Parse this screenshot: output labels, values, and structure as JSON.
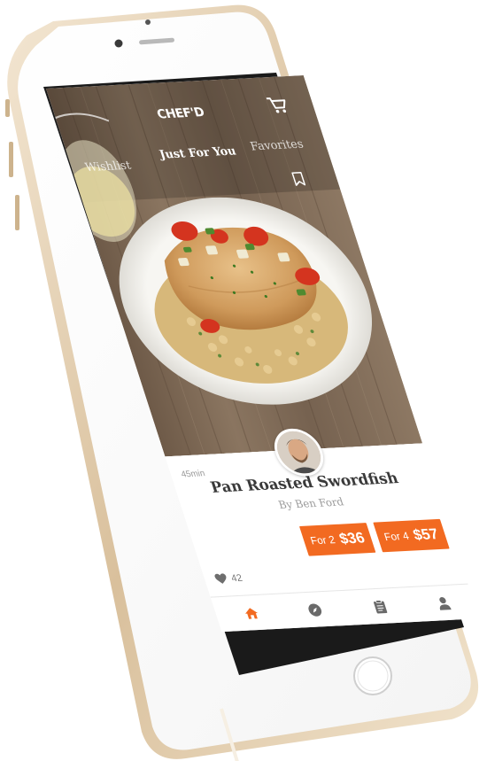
{
  "header": {
    "logo_text": "CHEF'D"
  },
  "tabs": [
    {
      "label": "Wishlist",
      "active": false
    },
    {
      "label": "Just For You",
      "active": true
    },
    {
      "label": "Favorites",
      "active": false
    }
  ],
  "recipe": {
    "duration": "45min",
    "title": "Pan Roasted Swordfish",
    "byline": "By Ben Ford",
    "likes": "42"
  },
  "pricing": [
    {
      "size_label": "For 2",
      "price": "$36"
    },
    {
      "size_label": "For 4",
      "price": "$57"
    }
  ],
  "bottom_nav": [
    {
      "icon": "home-icon",
      "active": true
    },
    {
      "icon": "compass-icon",
      "active": false
    },
    {
      "icon": "clipboard-icon",
      "active": false
    },
    {
      "icon": "user-icon",
      "active": false
    }
  ],
  "colors": {
    "accent": "#f26a21",
    "device_gold": "#e9d6b9",
    "title_text": "#3a3a3a",
    "muted_text": "#9a9a9a"
  }
}
